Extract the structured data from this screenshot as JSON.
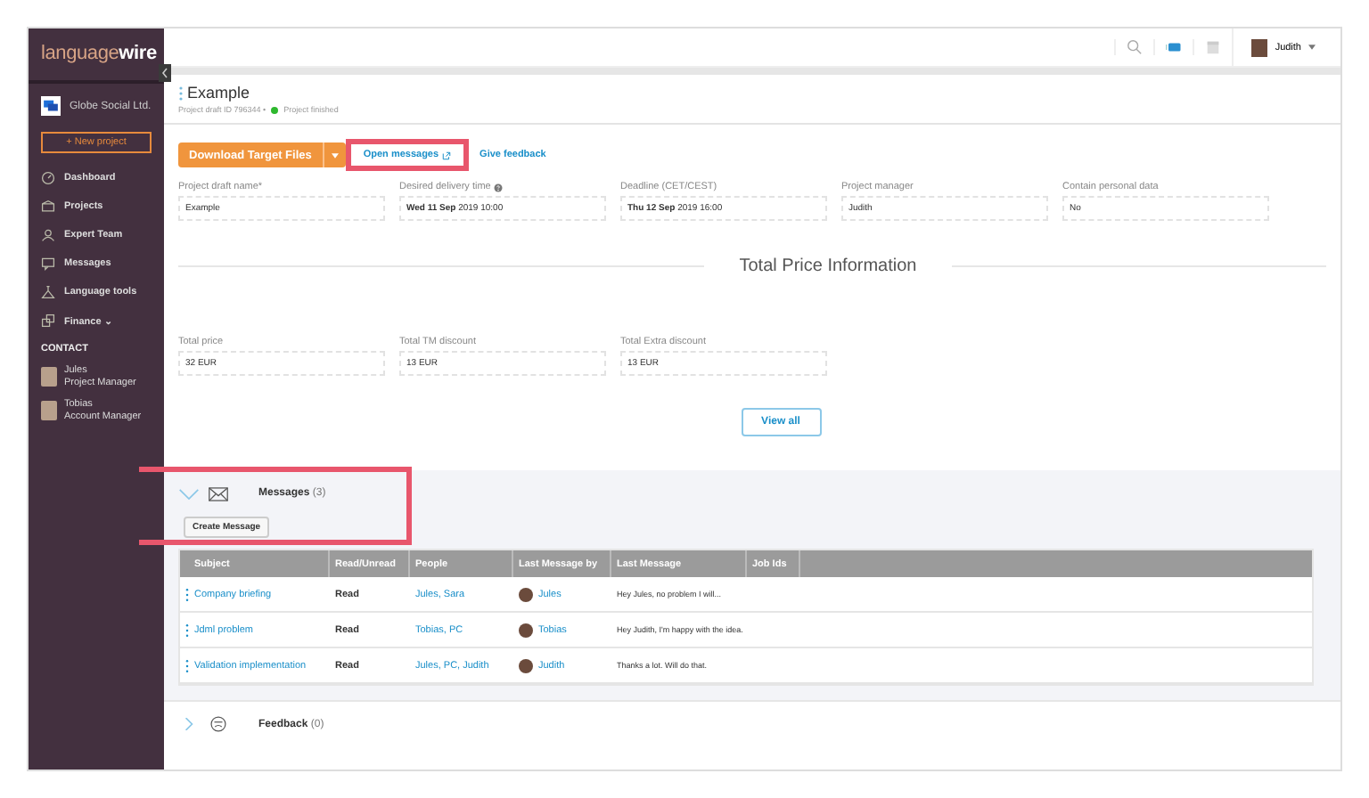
{
  "sidebar": {
    "logo": {
      "light": "language",
      "bold": "wire"
    },
    "company": "Globe Social Ltd.",
    "new_project": "+ New project",
    "items": [
      {
        "label": "Dashboard",
        "kind": "dashboard"
      },
      {
        "label": "Projects",
        "kind": "box"
      },
      {
        "label": "Expert Team",
        "kind": "team"
      },
      {
        "label": "Messages",
        "kind": "chat"
      },
      {
        "label": "Language tools",
        "kind": "tools"
      },
      {
        "label": "Finance ⌄",
        "kind": "finance"
      }
    ],
    "contact_heading": "CONTACT",
    "contacts": [
      {
        "name": "Jules",
        "role": "Project Manager"
      },
      {
        "name": "Tobias",
        "role": "Account Manager"
      }
    ]
  },
  "topbar": {
    "user": "Judith"
  },
  "project": {
    "title": "Example",
    "id": "Project draft ID 796344 •",
    "status": "Project finished"
  },
  "actions": {
    "download": "Download Target Files",
    "open_messages": "Open messages",
    "feedback": "Give feedback"
  },
  "fields": [
    {
      "label": "Project draft name*",
      "value": "Example",
      "help": false
    },
    {
      "label": "Desired delivery time",
      "value": "**Wed 11 Sep** 2019 10:00",
      "help": true
    },
    {
      "label": "Deadline (CET/CEST)",
      "value": "**Thu 12 Sep** 2019 16:00",
      "help": false
    },
    {
      "label": "Project manager",
      "value": "Judith",
      "help": false
    },
    {
      "label": "Contain personal data",
      "value": "No",
      "help": false
    }
  ],
  "price": {
    "title": "Total Price Information",
    "fields": [
      {
        "label": "Total price",
        "value": "32 EUR"
      },
      {
        "label": "Total TM discount",
        "value": "13 EUR"
      },
      {
        "label": "Total Extra discount",
        "value": "13 EUR"
      }
    ],
    "view_all": "View all"
  },
  "messages": {
    "title": "Messages",
    "count": "(3)",
    "expanded": true,
    "create": "Create Message",
    "columns": [
      "Subject",
      "Read/Unread",
      "People",
      "Last Message by",
      "Last Message",
      "Job Ids"
    ],
    "rows": [
      {
        "subject": "Company briefing",
        "status": "Read",
        "people": "Jules, Sara",
        "by": "Jules",
        "last": "Hey Jules, no problem I will..."
      },
      {
        "subject": "Jdml problem",
        "status": "Read",
        "people": "Tobias, PC",
        "by": "Tobias",
        "last": "Hey Judith, I'm happy with the idea."
      },
      {
        "subject": "Validation implementation",
        "status": "Read",
        "people": "Jules, PC, Judith",
        "by": "Judith",
        "last": "Thanks a lot. Will do that."
      }
    ]
  },
  "feedback": {
    "title": "Feedback",
    "count": "(0)",
    "expanded": false
  }
}
